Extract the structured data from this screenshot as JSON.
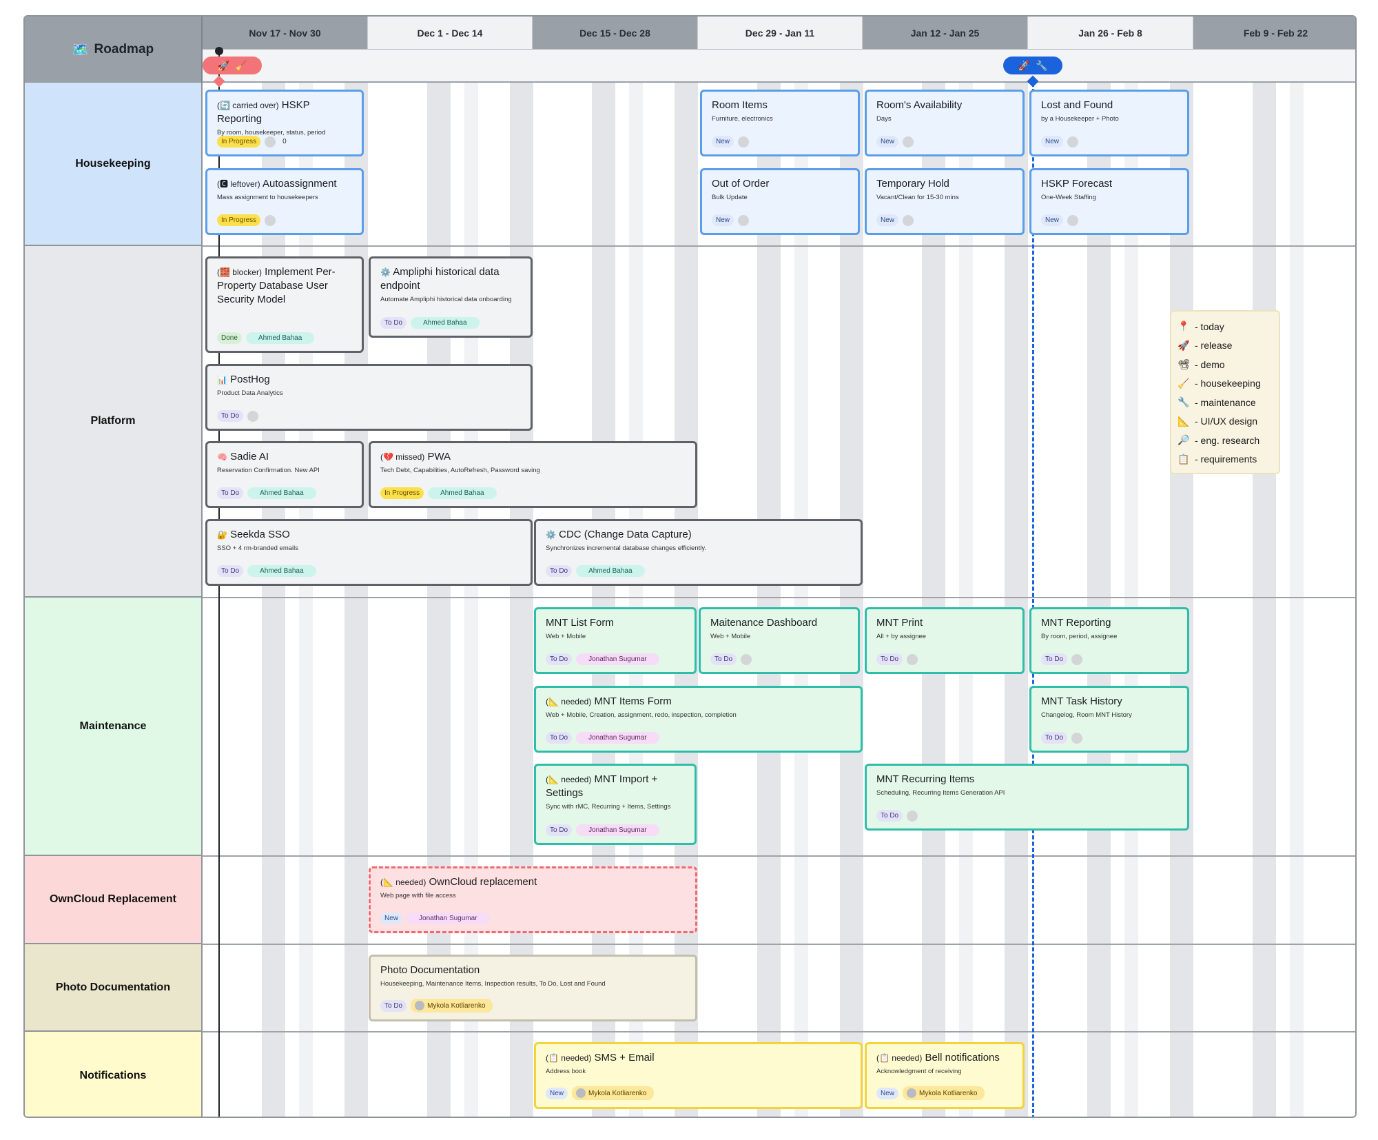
{
  "roadmap": {
    "title": "Roadmap",
    "icon": "map-icon",
    "periods": [
      "Nov 17 - Nov 30",
      "Dec 1 - Dec 14",
      "Dec 15 - Dec 28",
      "Dec 29 - Jan 11",
      "Jan 12 - Jan 25",
      "Jan 26 - Feb 8",
      "Feb 9 - Feb 22"
    ],
    "milestones": [
      {
        "icons": [
          "rocket-icon",
          "broom-icon"
        ],
        "color": "#f27479"
      },
      {
        "icons": [
          "rocket-icon",
          "wrench-icon"
        ],
        "color": "#1a63dc"
      }
    ],
    "lanes": [
      "Housekeeping",
      "Platform",
      "Maintenance",
      "OwnCloud Replacement",
      "Photo Documentation",
      "Notifications"
    ],
    "lane_colors": {
      "Housekeeping": "#cfe4fb",
      "Platform": "#e6e8eb",
      "Maintenance": "#e0f9e6",
      "OwnCloud Replacement": "#fdd8d8",
      "Photo Documentation": "#eae6cc",
      "Notifications": "#fffbcc"
    }
  },
  "cards": [
    {
      "prefix": "(🔄 carried over)",
      "title": "HSKP Reporting",
      "subtitle": "By room, housekeeper, status, period",
      "status": "In Progress",
      "assignee": "",
      "count": "0"
    },
    {
      "prefix": "(🅲 leftover)",
      "title": "Autoassignment",
      "subtitle": "Mass assignment to housekeepers",
      "status": "In Progress",
      "assignee": ""
    },
    {
      "prefix": "",
      "title": "Room Items",
      "subtitle": "Furniture, electronics",
      "status": "New",
      "assignee": ""
    },
    {
      "prefix": "",
      "title": "Room's Availability",
      "subtitle": "Days",
      "status": "New",
      "assignee": ""
    },
    {
      "prefix": "",
      "title": "Lost and Found",
      "subtitle": "by a Housekeeper + Photo",
      "status": "New",
      "assignee": ""
    },
    {
      "prefix": "",
      "title": "Out of Order",
      "subtitle": "Bulk Update",
      "status": "New",
      "assignee": ""
    },
    {
      "prefix": "",
      "title": "Temporary Hold",
      "subtitle": "Vacant/Clean for 15-30 mins",
      "status": "New",
      "assignee": ""
    },
    {
      "prefix": "",
      "title": "HSKP Forecast",
      "subtitle": "One-Week Staffing",
      "status": "New",
      "assignee": ""
    },
    {
      "prefix": "(🧱 blocker)",
      "title": "Implement Per-Property Database User Security Model",
      "subtitle": "",
      "status": "Done",
      "assignee": "Ahmed Bahaa"
    },
    {
      "prefix": "⚙️",
      "title": "Ampliphi historical data endpoint",
      "subtitle": "Automate Ampliphi historical data onboarding",
      "status": "To Do",
      "assignee": "Ahmed Bahaa"
    },
    {
      "prefix": "📊",
      "title": "PostHog",
      "subtitle": "Product Data Analytics",
      "status": "To Do",
      "assignee": ""
    },
    {
      "prefix": "🧠",
      "title": "Sadie AI",
      "subtitle": "Reservation Confirmation. New API",
      "status": "To Do",
      "assignee": "Ahmed Bahaa"
    },
    {
      "prefix": "(💔 missed)",
      "title": "PWA",
      "subtitle": "Tech Debt, Capabilities, AutoRefresh, Password saving",
      "status": "In Progress",
      "assignee": "Ahmed Bahaa"
    },
    {
      "prefix": "🔐",
      "title": "Seekda SSO",
      "subtitle": "SSO + 4 rm-branded emails",
      "status": "To Do",
      "assignee": "Ahmed Bahaa"
    },
    {
      "prefix": "⚙️",
      "title": "CDC (Change Data Capture)",
      "subtitle": "Synchronizes incremental database changes efficiently.",
      "status": "To Do",
      "assignee": "Ahmed Bahaa"
    },
    {
      "prefix": "",
      "title": "MNT List Form",
      "subtitle": "Web + Mobile",
      "status": "To Do",
      "assignee": "Jonathan Sugumar"
    },
    {
      "prefix": "",
      "title": "Maitenance Dashboard",
      "subtitle": "Web + Mobile",
      "status": "To Do",
      "assignee": ""
    },
    {
      "prefix": "",
      "title": "MNT Print",
      "subtitle": "All + by assignee",
      "status": "To Do",
      "assignee": ""
    },
    {
      "prefix": "",
      "title": "MNT Reporting",
      "subtitle": "By room, period, assignee",
      "status": "To Do",
      "assignee": ""
    },
    {
      "prefix": "(📐 needed)",
      "title": "MNT Items Form",
      "subtitle": "Web + Mobile, Creation, assignment, redo, inspection, completion",
      "status": "To Do",
      "assignee": "Jonathan Sugumar"
    },
    {
      "prefix": "",
      "title": "MNT Task History",
      "subtitle": "Changelog, Room MNT History",
      "status": "To Do",
      "assignee": ""
    },
    {
      "prefix": "(📐 needed)",
      "title": "MNT Import + Settings",
      "subtitle": "Sync with rMC, Recurring + Items, Settings",
      "status": "To Do",
      "assignee": "Jonathan Sugumar"
    },
    {
      "prefix": "",
      "title": "MNT Recurring Items",
      "subtitle": "Scheduling, Recurring Items Generation API",
      "status": "To Do",
      "assignee": ""
    },
    {
      "prefix": "(📐 needed)",
      "title": "OwnCloud replacement",
      "subtitle": "Web page with file access",
      "status": "New",
      "assignee": "Jonathan Sugumar"
    },
    {
      "prefix": "",
      "title": "Photo Documentation",
      "subtitle": "Housekeeping, Maintenance Items, Inspection results, To Do, Lost and Found",
      "status": "To Do",
      "assignee": "Mykola Kotliarenko"
    },
    {
      "prefix": "(📋 needed)",
      "title": "SMS + Email",
      "subtitle": "Address book",
      "status": "New",
      "assignee": "Mykola Kotliarenko"
    },
    {
      "prefix": "(📋 needed)",
      "title": "Bell notifications",
      "subtitle": "Acknowledgment of receiving",
      "status": "New",
      "assignee": "Mykola Kotliarenko"
    }
  ],
  "legend": [
    {
      "icon": "📍",
      "label": "- today"
    },
    {
      "icon": "🚀",
      "label": "- release"
    },
    {
      "icon": "📽",
      "label": "- demo"
    },
    {
      "icon": "🧹",
      "label": "- housekeeping"
    },
    {
      "icon": "🔧",
      "label": "- maintenance"
    },
    {
      "icon": "📐",
      "label": "- UI/UX design"
    },
    {
      "icon": "🔎",
      "label": "- eng. research"
    },
    {
      "icon": "📋",
      "label": "- requirements"
    }
  ]
}
